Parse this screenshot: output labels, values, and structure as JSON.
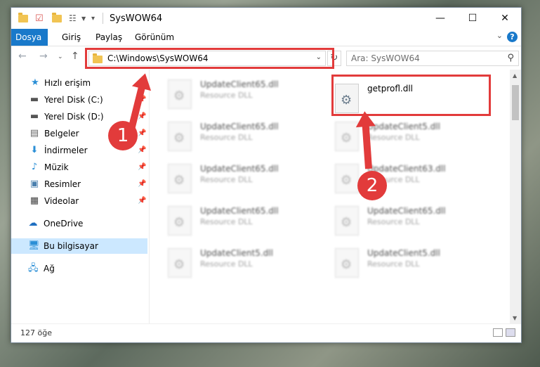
{
  "window": {
    "title": "SysWOW64",
    "controls": {
      "minimize": "—",
      "maximize": "☐",
      "close": "✕"
    }
  },
  "ribbon": {
    "tabs": [
      "Dosya",
      "Giriş",
      "Paylaş",
      "Görünüm"
    ],
    "help": "?"
  },
  "nav": {
    "address": "C:\\Windows\\SysWOW64",
    "search_placeholder": "Ara: SysWOW64"
  },
  "sidebar": {
    "items": [
      {
        "label": "Hızlı erişim",
        "icon": "star-icon"
      },
      {
        "label": "Yerel Disk (C:)",
        "icon": "drive-icon"
      },
      {
        "label": "Yerel Disk (D:)",
        "icon": "drive-icon"
      },
      {
        "label": "Belgeler",
        "icon": "documents-icon"
      },
      {
        "label": "İndirmeler",
        "icon": "download-icon"
      },
      {
        "label": "Müzik",
        "icon": "music-icon"
      },
      {
        "label": "Resimler",
        "icon": "pictures-icon"
      },
      {
        "label": "Videolar",
        "icon": "video-icon"
      },
      {
        "label": "OneDrive",
        "icon": "cloud-icon"
      },
      {
        "label": "Bu bilgisayar",
        "icon": "computer-icon"
      },
      {
        "label": "Ağ",
        "icon": "network-icon"
      }
    ]
  },
  "files": {
    "left": [
      {
        "name": "UpdateClient65.dll",
        "type": "Resource DLL"
      },
      {
        "name": "UpdateClient65.dll",
        "type": "Resource DLL"
      },
      {
        "name": "UpdateClient65.dll",
        "type": "Resource DLL"
      },
      {
        "name": "UpdateClient65.dll",
        "type": "Resource DLL"
      },
      {
        "name": "UpdateClient5.dll",
        "type": "Resource DLL"
      }
    ],
    "right": [
      {
        "name": "getprofl.dll",
        "type": ""
      },
      {
        "name": "UpdateClient5.dll",
        "type": "Resource DLL"
      },
      {
        "name": "UpdateClient63.dll",
        "type": "Resource DLL"
      },
      {
        "name": "UpdateClient65.dll",
        "type": "Resource DLL"
      },
      {
        "name": "UpdateClient5.dll",
        "type": "Resource DLL"
      }
    ]
  },
  "status": {
    "count": "127 öğe"
  },
  "annotations": {
    "badge1": "1",
    "badge2": "2",
    "accent": "#e23b3b"
  }
}
